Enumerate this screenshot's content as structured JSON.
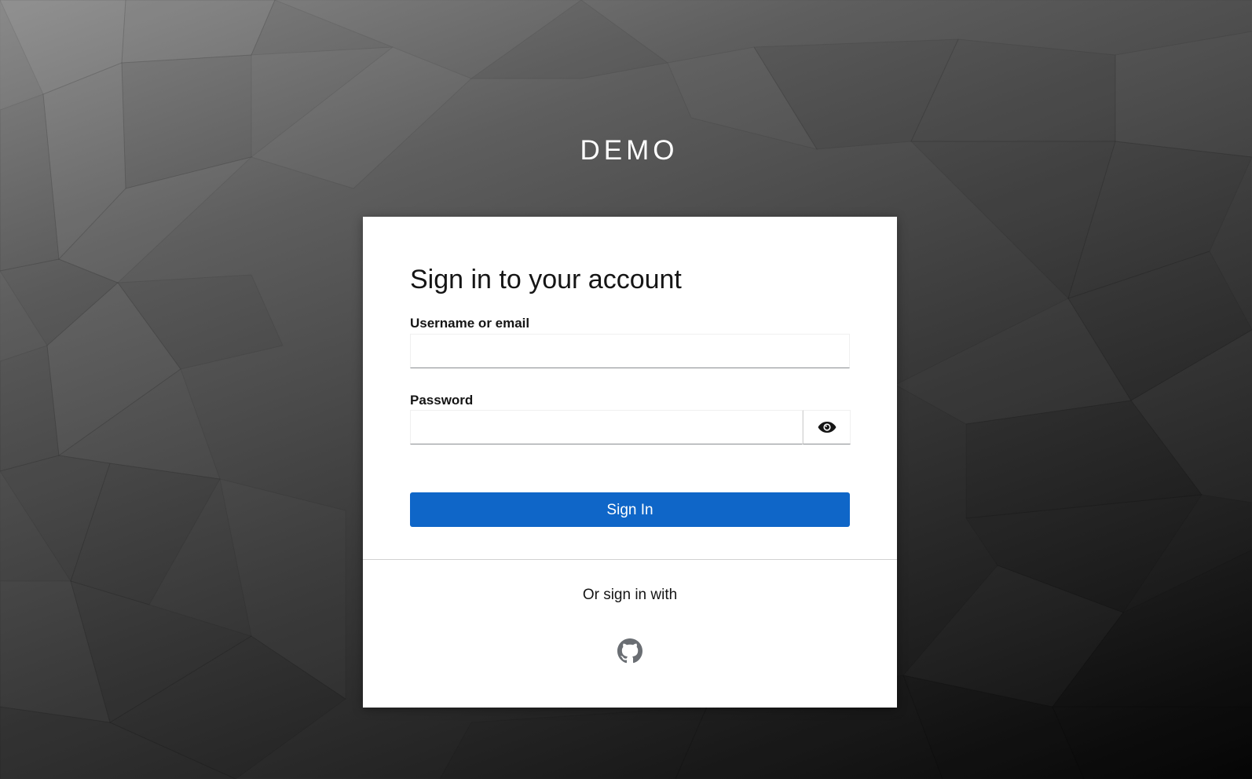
{
  "realm": {
    "title": "DEMO"
  },
  "login": {
    "heading": "Sign in to your account",
    "username_label": "Username or email",
    "username_value": "",
    "password_label": "Password",
    "password_value": "",
    "submit_label": "Sign In"
  },
  "social": {
    "intro": "Or sign in with",
    "providers": [
      {
        "icon": "github-icon"
      }
    ]
  },
  "colors": {
    "primary_button": "#0f66c8",
    "card_background": "#ffffff",
    "heading_text": "#151515"
  }
}
